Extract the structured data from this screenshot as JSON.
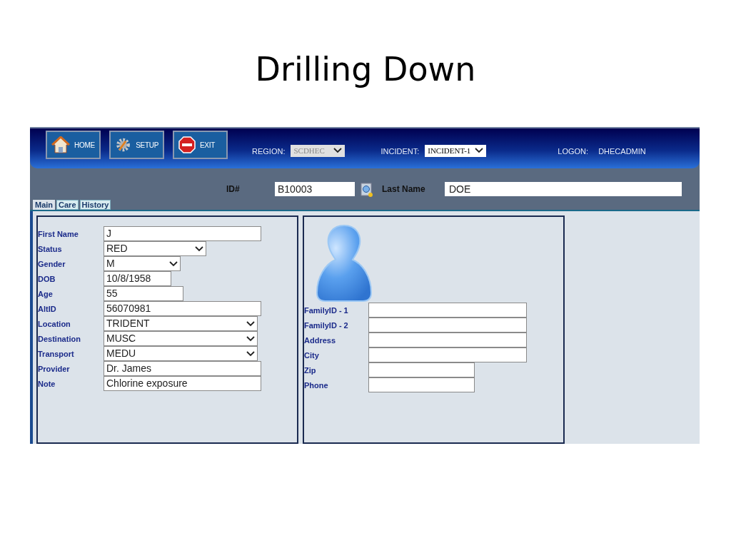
{
  "slide": {
    "title": "Drilling Down"
  },
  "toolbar": {
    "buttons": [
      {
        "kind": "home",
        "label": "HOME"
      },
      {
        "kind": "setup",
        "label": "SETUP"
      },
      {
        "kind": "exit",
        "label": "EXIT"
      }
    ],
    "region": {
      "label": "REGION:",
      "value": "SCDHEC",
      "disabled": true
    },
    "incident": {
      "label": "INCIDENT:",
      "value": "INCIDENT-1",
      "disabled": false
    },
    "logon": {
      "label": "LOGON:",
      "value": "DHECADMIN"
    }
  },
  "search_bar": {
    "id_label": "ID#",
    "id_value": "B10003",
    "last_name_label": "Last Name",
    "last_name_value": "DOE"
  },
  "tabs": [
    {
      "label": "Main",
      "selected": true
    },
    {
      "label": "Care",
      "selected": false
    },
    {
      "label": "History",
      "selected": false
    }
  ],
  "patient_fields": [
    {
      "label": "First Name",
      "kind": "text",
      "value": "J"
    },
    {
      "label": "Status",
      "kind": "select",
      "value": "RED"
    },
    {
      "label": "Gender",
      "kind": "select",
      "value": "M"
    },
    {
      "label": "DOB",
      "kind": "text",
      "value": "10/8/1958"
    },
    {
      "label": "Age",
      "kind": "text",
      "value": "55"
    },
    {
      "label": "AltID",
      "kind": "text",
      "value": "56070981"
    },
    {
      "label": "Location",
      "kind": "select",
      "value": "TRIDENT"
    },
    {
      "label": "Destination",
      "kind": "select",
      "value": "MUSC"
    },
    {
      "label": "Transport",
      "kind": "select",
      "value": "MEDU"
    },
    {
      "label": "Provider",
      "kind": "text",
      "value": "Dr. James"
    },
    {
      "label": "Note",
      "kind": "text",
      "value": "Chlorine exposure"
    }
  ],
  "family_fields": [
    {
      "label": "FamilyID - 1"
    },
    {
      "label": "FamilyID - 2"
    },
    {
      "label": "Address"
    },
    {
      "label": "City"
    },
    {
      "label": "Zip"
    },
    {
      "label": "Phone"
    }
  ]
}
